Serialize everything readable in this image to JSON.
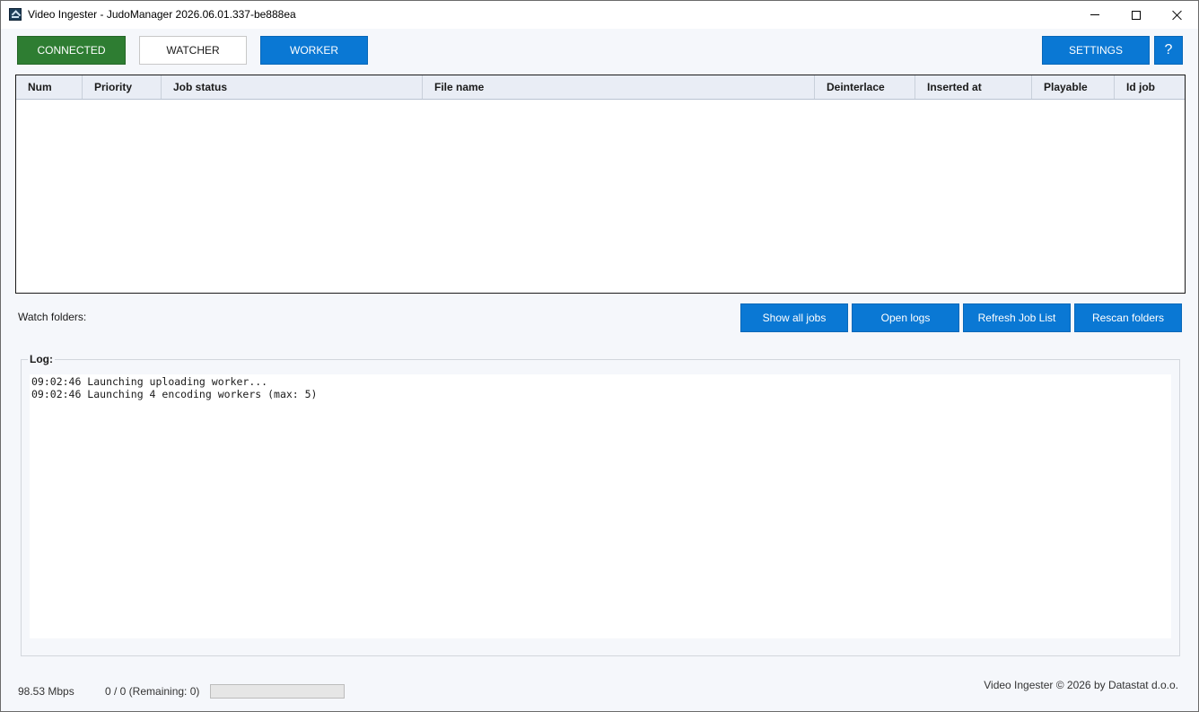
{
  "window": {
    "title": "Video Ingester - JudoManager  2026.06.01.337-be888ea",
    "icon": "upload-icon"
  },
  "toolbar": {
    "connected_label": "CONNECTED",
    "watcher_label": "WATCHER",
    "worker_label": "WORKER",
    "settings_label": "SETTINGS",
    "help_label": "?"
  },
  "jobs_table": {
    "columns": [
      "Num",
      "Priority",
      "Job status",
      "File name",
      "Deinterlace",
      "Inserted at",
      "Playable",
      "Id job"
    ],
    "rows": []
  },
  "watch": {
    "label": "Watch folders:",
    "buttons": {
      "show_all": "Show all jobs",
      "open_logs": "Open logs",
      "refresh": "Refresh Job List",
      "rescan": "Rescan folders"
    }
  },
  "log": {
    "title": "Log:",
    "lines": [
      "09:02:46 Launching uploading worker...",
      "09:02:46 Launching 4 encoding workers (max: 5)"
    ]
  },
  "status": {
    "speed": "98.53 Mbps",
    "counts": "0 / 0 (Remaining: 0)",
    "progress_fraction": 0,
    "copyright": "Video Ingester © 2026 by Datastat d.o.o."
  },
  "colors": {
    "connected": "#2e7d32",
    "accent": "#0a78d4",
    "background": "#f5f7fb"
  }
}
